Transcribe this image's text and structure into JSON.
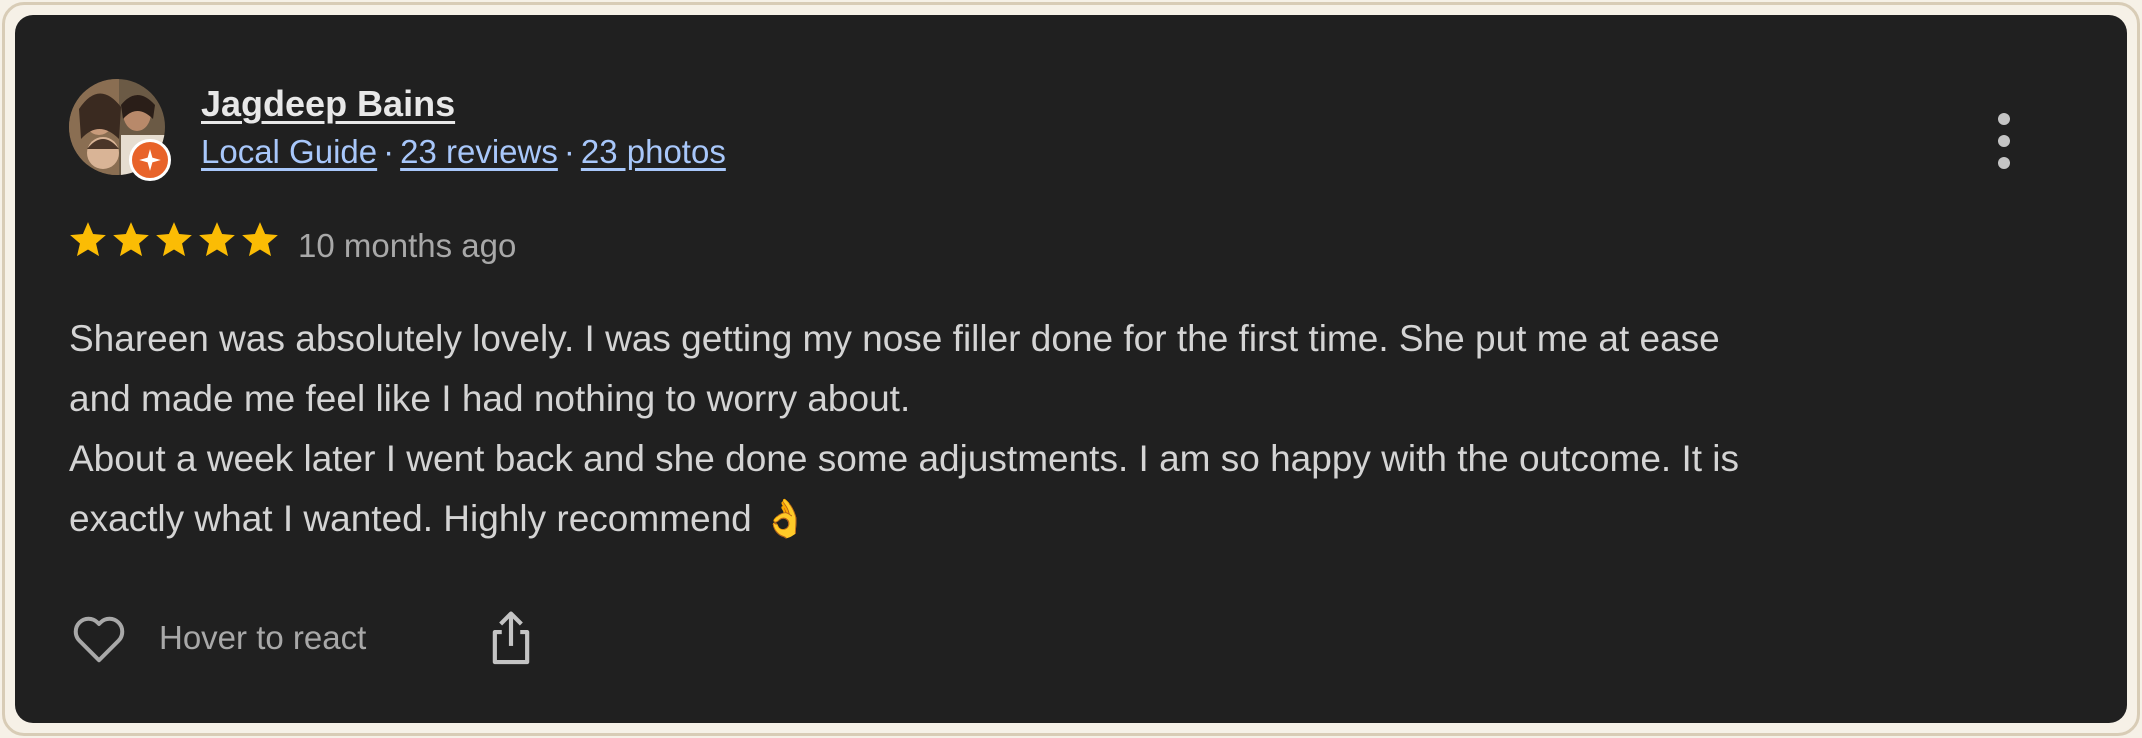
{
  "reviewer": {
    "name": "Jagdeep Bains",
    "badge_icon": "local-guide-star-icon",
    "local_guide_label": "Local Guide",
    "separator": "·",
    "reviews_label": "23 reviews",
    "photos_label": "23 photos"
  },
  "review": {
    "rating": 5,
    "max_rating": 5,
    "time_ago": "10 months ago",
    "text_lines": [
      "Shareen was absolutely lovely. I was getting my nose filler done for the first time. She put me at ease",
      "and made me feel like I had nothing to worry about.",
      "About a week later I went back and she done some adjustments. I am so happy with the outcome. It is",
      "exactly what I wanted. Highly recommend 👌"
    ]
  },
  "actions": {
    "react_label": "Hover to react",
    "heart_icon": "heart-outline-icon",
    "share_icon": "share-icon",
    "more_icon": "more-vertical-icon"
  },
  "colors": {
    "card_bg": "#202020",
    "page_bg": "#f6f1e7",
    "link": "#a8c7fa",
    "star": "#fbbc04",
    "badge": "#e8632a",
    "muted": "#a8a8a8"
  }
}
